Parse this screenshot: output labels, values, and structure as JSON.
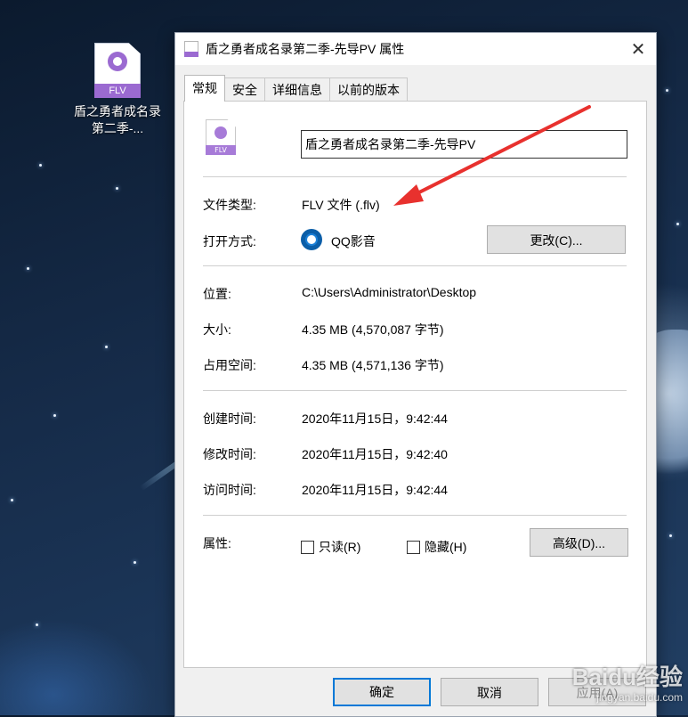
{
  "desktop": {
    "file_label": "盾之勇者成名录第二季-...",
    "badge": "FLV"
  },
  "dialog": {
    "title": "盾之勇者成名录第二季-先导PV 属性",
    "close_glyph": "✕",
    "tabs": [
      {
        "label": "常规",
        "active": true
      },
      {
        "label": "安全"
      },
      {
        "label": "详细信息"
      },
      {
        "label": "以前的版本"
      }
    ],
    "general": {
      "file_name": "盾之勇者成名录第二季-先导PV",
      "file_icon_badge": "FLV",
      "file_type_label": "文件类型:",
      "file_type_value": "FLV 文件 (.flv)",
      "open_with_label": "打开方式:",
      "open_with_value": "QQ影音",
      "open_with_icon": "qq-player-icon",
      "change_button": "更改(C)...",
      "location_label": "位置:",
      "location_value": "C:\\Users\\Administrator\\Desktop",
      "size_label": "大小:",
      "size_value": "4.35 MB (4,570,087 字节)",
      "disk_size_label": "占用空间:",
      "disk_size_value": "4.35 MB (4,571,136 字节)",
      "created_label": "创建时间:",
      "created_value": "2020年11月15日，9:42:44",
      "modified_label": "修改时间:",
      "modified_value": "2020年11月15日，9:42:40",
      "accessed_label": "访问时间:",
      "accessed_value": "2020年11月15日，9:42:44",
      "attributes_label": "属性:",
      "readonly_label": "只读(R)",
      "hidden_label": "隐藏(H)",
      "readonly_checked": false,
      "hidden_checked": false,
      "advanced_button": "高级(D)..."
    },
    "footer": {
      "ok": "确定",
      "cancel": "取消",
      "apply": "应用(A)"
    }
  },
  "colors": {
    "accent": "#0078d7",
    "annotation_arrow": "#e8312e",
    "file_badge": "#9b6ad1"
  },
  "watermark": {
    "brand": "Baidu经验",
    "site": "jingyan.baidu.com"
  }
}
